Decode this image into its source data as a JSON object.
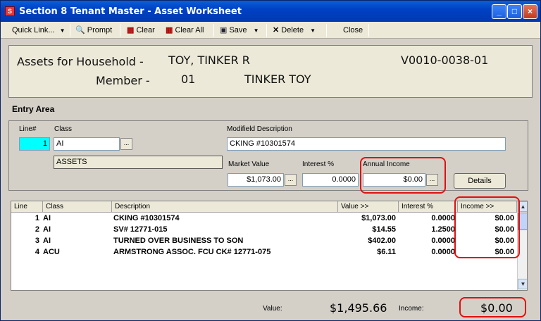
{
  "window": {
    "title": "Section 8 Tenant Master - Asset Worksheet"
  },
  "toolbar": {
    "quick_link": "Quick Link...",
    "prompt": "Prompt",
    "clear": "Clear",
    "clear_all": "Clear All",
    "save": "Save",
    "delete": "Delete",
    "close": "Close"
  },
  "header": {
    "assets_label": "Assets for Household -",
    "household_name": "TOY, TINKER R",
    "household_id": "V0010-0038-01",
    "member_label": "Member -",
    "member_number": "01",
    "member_name": "TINKER TOY"
  },
  "entry": {
    "section_title": "Entry Area",
    "line_label": "Line#",
    "line_value": "1",
    "class_label": "Class",
    "class_value": "AI",
    "class_description": "ASSETS",
    "modified_desc_label": "Modifield Description",
    "modified_desc_value": "CKING #10301574",
    "market_value_label": "Market Value",
    "market_value": "$1,073.00",
    "interest_label": "Interest %",
    "interest_value": "0.0000",
    "annual_income_label": "Annual Income",
    "annual_income_value": "$0.00",
    "details_button": "Details"
  },
  "grid": {
    "columns": [
      "Line",
      "Class",
      "Description",
      "Value >>",
      "Interest %",
      "Income >>"
    ],
    "rows": [
      {
        "line": "1",
        "class": "AI",
        "description": "CKING #10301574",
        "value": "$1,073.00",
        "interest": "0.0000",
        "income": "$0.00"
      },
      {
        "line": "2",
        "class": "AI",
        "description": "SV# 12771-015",
        "value": "$14.55",
        "interest": "1.2500",
        "income": "$0.00"
      },
      {
        "line": "3",
        "class": "AI",
        "description": "TURNED OVER BUSINESS TO SON",
        "value": "$402.00",
        "interest": "0.0000",
        "income": "$0.00"
      },
      {
        "line": "4",
        "class": "ACU",
        "description": "ARMSTRONG  ASSOC. FCU CK# 12771-075",
        "value": "$6.11",
        "interest": "0.0000",
        "income": "$0.00"
      }
    ]
  },
  "footer": {
    "value_label": "Value:",
    "value_total": "$1,495.66",
    "income_label": "Income:",
    "income_total": "$0.00"
  },
  "colors": {
    "highlight_red": "#e01010",
    "titlebar_blue": "#0041c4",
    "selected_line": "#00ffff"
  }
}
